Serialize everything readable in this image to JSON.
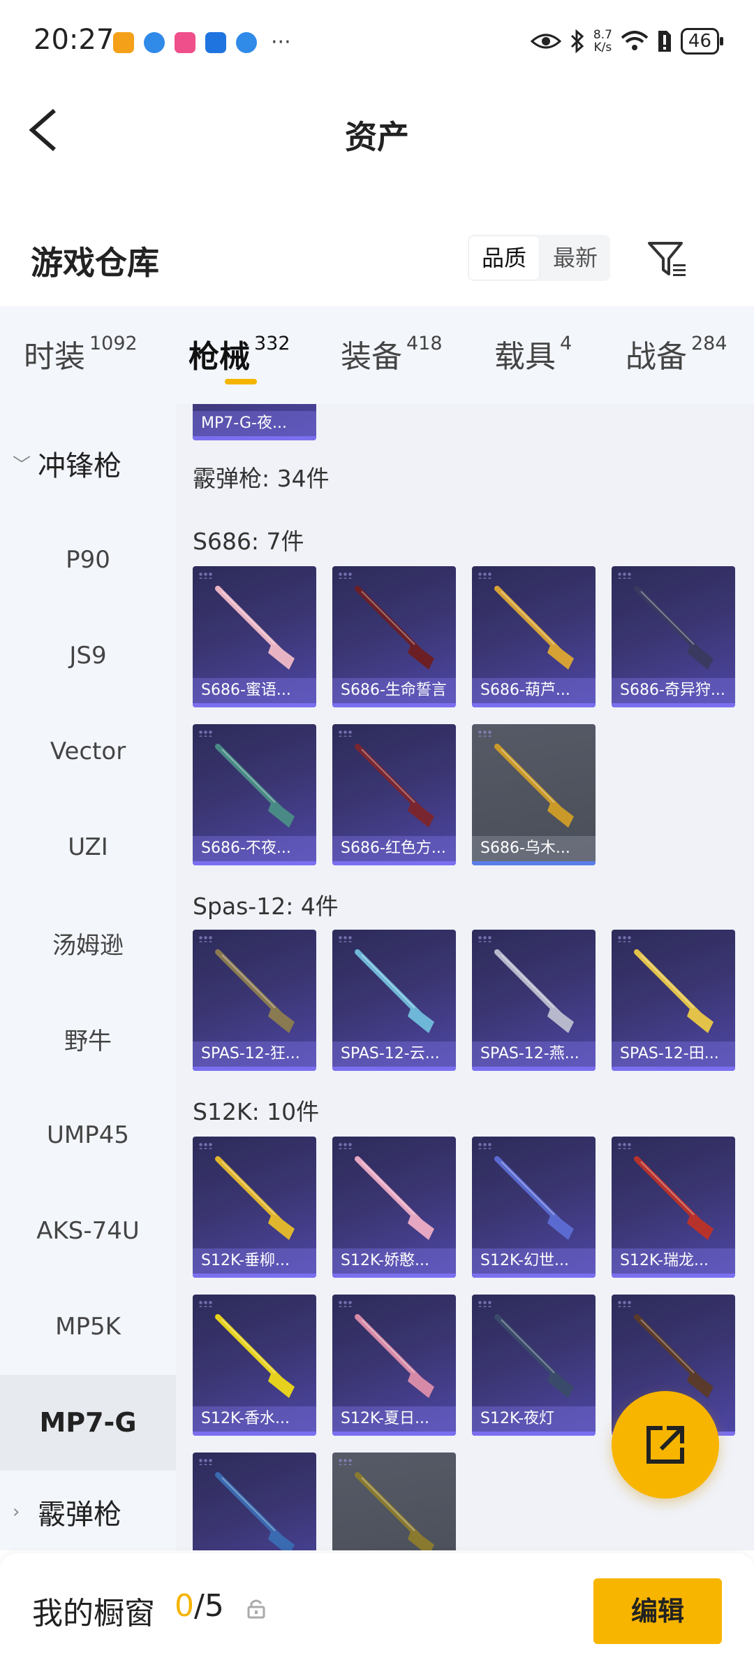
{
  "status_bar": {
    "time": "20:27",
    "net_speed_value": "8.7",
    "net_speed_unit": "K/s",
    "battery": "46"
  },
  "header": {
    "title": "资产"
  },
  "section": {
    "title": "游戏仓库",
    "sort_options": [
      "品质",
      "最新"
    ],
    "active_sort": "品质"
  },
  "tabs": [
    {
      "label": "时装",
      "count": "1092"
    },
    {
      "label": "枪械",
      "count": "332"
    },
    {
      "label": "装备",
      "count": "418"
    },
    {
      "label": "载具",
      "count": "4"
    },
    {
      "label": "战备",
      "count": "284"
    }
  ],
  "active_tab": "枪械",
  "sidebar": {
    "group_top": "冲锋枪",
    "items": [
      "P90",
      "JS9",
      "Vector",
      "UZI",
      "汤姆逊",
      "野牛",
      "UMP45",
      "AKS-74U",
      "MP5K",
      "MP7-G"
    ],
    "active_item": "MP7-G",
    "group_bottom": "霰弹枪"
  },
  "content": {
    "partial_top_card": "MP7-G-夜...",
    "category_header": "霰弹枪: 34件",
    "groups": [
      {
        "label": "S686: 7件",
        "items": [
          {
            "name": "S686-蜜语...",
            "gun_color": "#e8b4c4"
          },
          {
            "name": "S686-生命誓言",
            "gun_color": "#6b1f24"
          },
          {
            "name": "S686-葫芦...",
            "gun_color": "#d6a236"
          },
          {
            "name": "S686-奇异狩...",
            "gun_color": "#3a3a60"
          },
          {
            "name": "S686-不夜...",
            "gun_color": "#4a8a86"
          },
          {
            "name": "S686-红色方...",
            "gun_color": "#7a2630"
          },
          {
            "name": "S686-乌木...",
            "gun_color": "#c99a2a",
            "grey": true
          }
        ]
      },
      {
        "label": "Spas-12: 4件",
        "items": [
          {
            "name": "SPAS-12-狂...",
            "gun_color": "#8a7a52"
          },
          {
            "name": "SPAS-12-云...",
            "gun_color": "#6fb7d8"
          },
          {
            "name": "SPAS-12-燕...",
            "gun_color": "#b8b8cc"
          },
          {
            "name": "SPAS-12-田...",
            "gun_color": "#e3c24a"
          }
        ]
      },
      {
        "label": "S12K: 10件",
        "items": [
          {
            "name": "S12K-垂柳...",
            "gun_color": "#e0b62e"
          },
          {
            "name": "S12K-娇憨...",
            "gun_color": "#e6a7c2"
          },
          {
            "name": "S12K-幻世...",
            "gun_color": "#5a6ad0"
          },
          {
            "name": "S12K-瑞龙...",
            "gun_color": "#b8322c"
          },
          {
            "name": "S12K-香水...",
            "gun_color": "#e6d21e"
          },
          {
            "name": "S12K-夏日...",
            "gun_color": "#d68aa8"
          },
          {
            "name": "S12K-夜灯",
            "gun_color": "#3a4a6a"
          },
          {
            "name": "",
            "gun_color": "#5a3a2a"
          },
          {
            "name": "",
            "gun_color": "#3a6ab0"
          },
          {
            "name": "",
            "gun_color": "#8a7a30",
            "grey": true
          }
        ]
      }
    ]
  },
  "bottom_bar": {
    "showcase_label": "我的橱窗",
    "showcase_current": "0",
    "showcase_sep_total": "/5",
    "edit_label": "编辑"
  },
  "colors": {
    "accent": "#f7b500",
    "card_bg": "#3a3570",
    "card_bar": "#7b6ff0"
  }
}
